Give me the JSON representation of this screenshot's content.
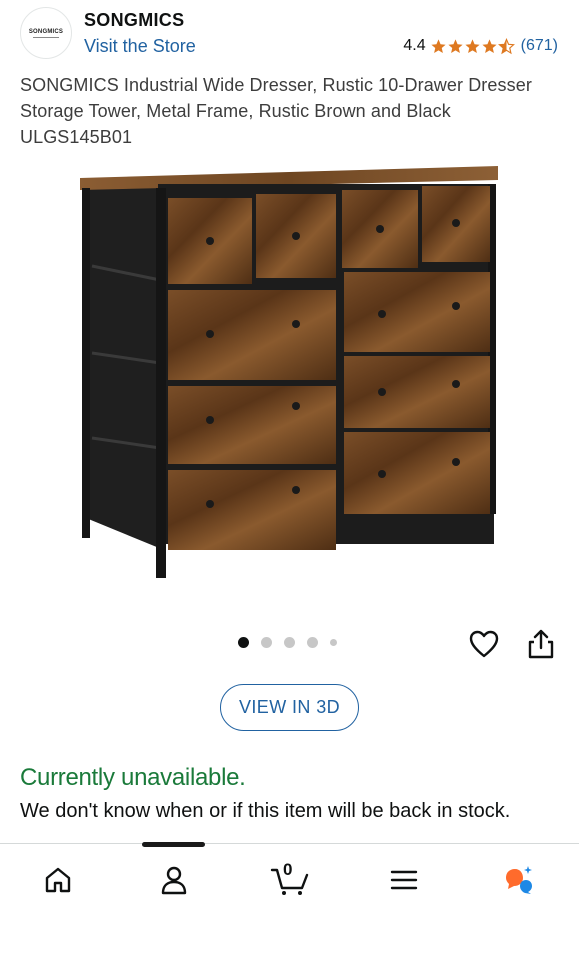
{
  "header": {
    "brand_logo_text": "SONGMICS",
    "brand_name": "SONGMICS",
    "visit_store_label": "Visit the Store",
    "rating_value": "4.4",
    "rating_stars": 4.4,
    "rating_count": "(671)"
  },
  "product": {
    "title": "SONGMICS Industrial Wide Dresser, Rustic 10-Drawer Dresser Storage Tower, Metal Frame, Rustic Brown and Black ULGS145B01",
    "image_count": 5,
    "active_image_index": 0,
    "view_3d_label": "VIEW IN 3D"
  },
  "availability": {
    "status": "Currently unavailable.",
    "note": "We don't know when or if this item will be back in stock."
  },
  "tabbar": {
    "cart_count": "0",
    "items": [
      "home-icon",
      "account-icon",
      "cart-icon",
      "menu-icon",
      "assistant-icon"
    ]
  },
  "colors": {
    "link": "#2162a1",
    "star": "#de7921",
    "unavailable": "#1a7a3a",
    "wood": "#6b4423",
    "frame": "#1c1c1c"
  }
}
